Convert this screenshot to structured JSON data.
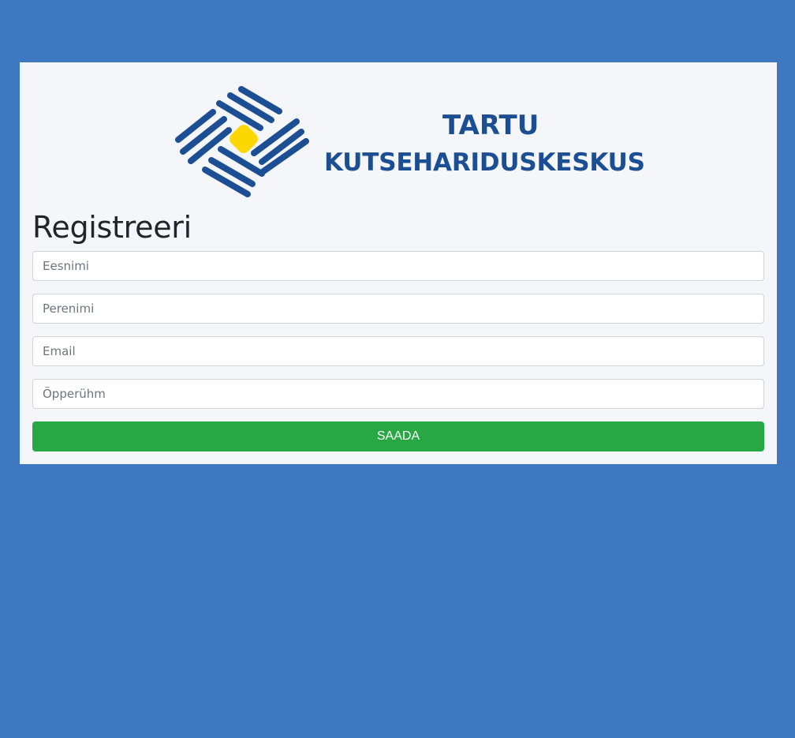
{
  "logo": {
    "line1": "TARTU",
    "line2": "KUTSEHARIDUSKESKUS",
    "mark_color": "#1c4e93",
    "accent_color": "#ffd700"
  },
  "form": {
    "title": "Registreeri",
    "fields": [
      {
        "placeholder": "Eesnimi",
        "value": ""
      },
      {
        "placeholder": "Perenimi",
        "value": ""
      },
      {
        "placeholder": "Email",
        "value": ""
      },
      {
        "placeholder": "Õpperühm",
        "value": ""
      }
    ],
    "submit_label": "SAADA",
    "submit_color": "#28a745"
  },
  "colors": {
    "background": "#3e78c0",
    "card": "#f4f6fa"
  }
}
